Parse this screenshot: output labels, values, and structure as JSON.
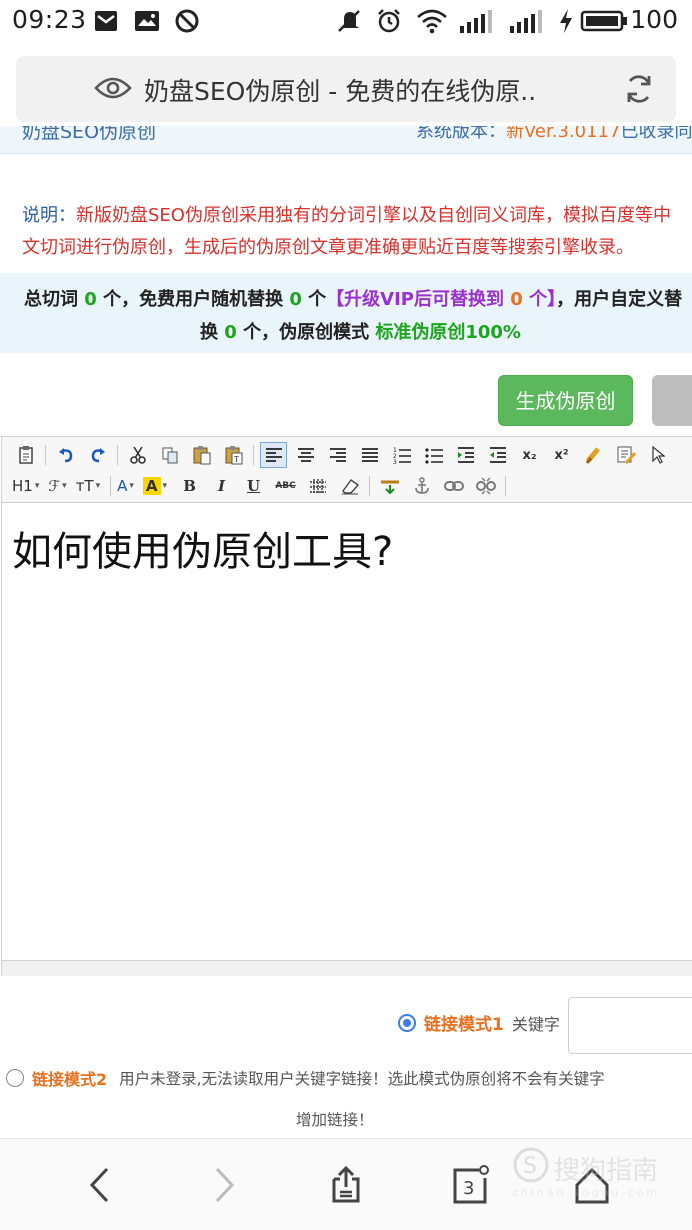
{
  "status_bar": {
    "time": "09:23",
    "battery": "100"
  },
  "address_bar": {
    "title": "奶盘SEO伪原创 - 免费的在线伪原.."
  },
  "site_header": {
    "name": "奶盘SEO伪原创",
    "version_label": "系统版本：",
    "version_value": "新Ver.3.0117",
    "version_suffix": "已收录同义"
  },
  "description": {
    "label": "说明：",
    "text": "新版奶盘SEO伪原创采用独有的分词引擎以及自创同义词库，模拟百度等中文切词进行伪原创，生成后的伪原创文章更准确更贴近百度等搜索引擎收录。"
  },
  "stats": {
    "total_prefix": "总切词 ",
    "total_count": "0",
    "free_prefix": " 个，免费用户随机替换 ",
    "free_count": "0",
    "free_suffix": " 个",
    "vip_prefix": "【升级VIP后可替换到 ",
    "vip_count": "0",
    "vip_suffix": " 个】",
    "custom_prefix": "，用户自定义替",
    "line2_prefix": "换 ",
    "custom_count": "0",
    "mode_prefix": " 个，伪原创模式 ",
    "mode_value": "标准伪原创100%"
  },
  "buttons": {
    "generate": "生成伪原创"
  },
  "toolbar": {
    "heading": "H1",
    "font_family": "ℱ",
    "font_size": "тT",
    "font_color": "A",
    "bg_color": "A",
    "bold": "B",
    "italic": "I",
    "underline": "U",
    "strike": "ABC",
    "superscript": "x²",
    "subscript": "x₂"
  },
  "editor": {
    "content": "如何使用伪原创工具?"
  },
  "link_modes": {
    "mode1_label": "链接模式1",
    "keyword_label": "关键字",
    "mode2_label": "链接模式2",
    "mode2_note": "用户未登录,无法读取用户关键字链接！选此模式伪原创将不会有关键字",
    "mode2_note2": "增加链接！"
  },
  "bottom_nav": {
    "tab_count": "3"
  },
  "watermark": {
    "text": "搜狗指南",
    "sub": "zhinan.sogou.com"
  },
  "colors": {
    "accent_green": "#5cb85c",
    "warning_red": "#d9302c",
    "highlight_orange": "#e87020",
    "vip_purple": "#9b30d0",
    "stats_bg": "#eaf4fb"
  },
  "icons": {
    "status_left": [
      "mail-icon",
      "image-message-icon",
      "blocked-icon"
    ],
    "status_right": [
      "mute-icon",
      "alarm-icon",
      "wifi-icon",
      "signal-icon",
      "signal-icon",
      "charging-icon",
      "battery-icon"
    ],
    "address": [
      "eye-icon",
      "reload-icon"
    ],
    "nav": [
      "back-icon",
      "forward-icon",
      "share-icon",
      "tabs-icon",
      "home-icon"
    ]
  }
}
